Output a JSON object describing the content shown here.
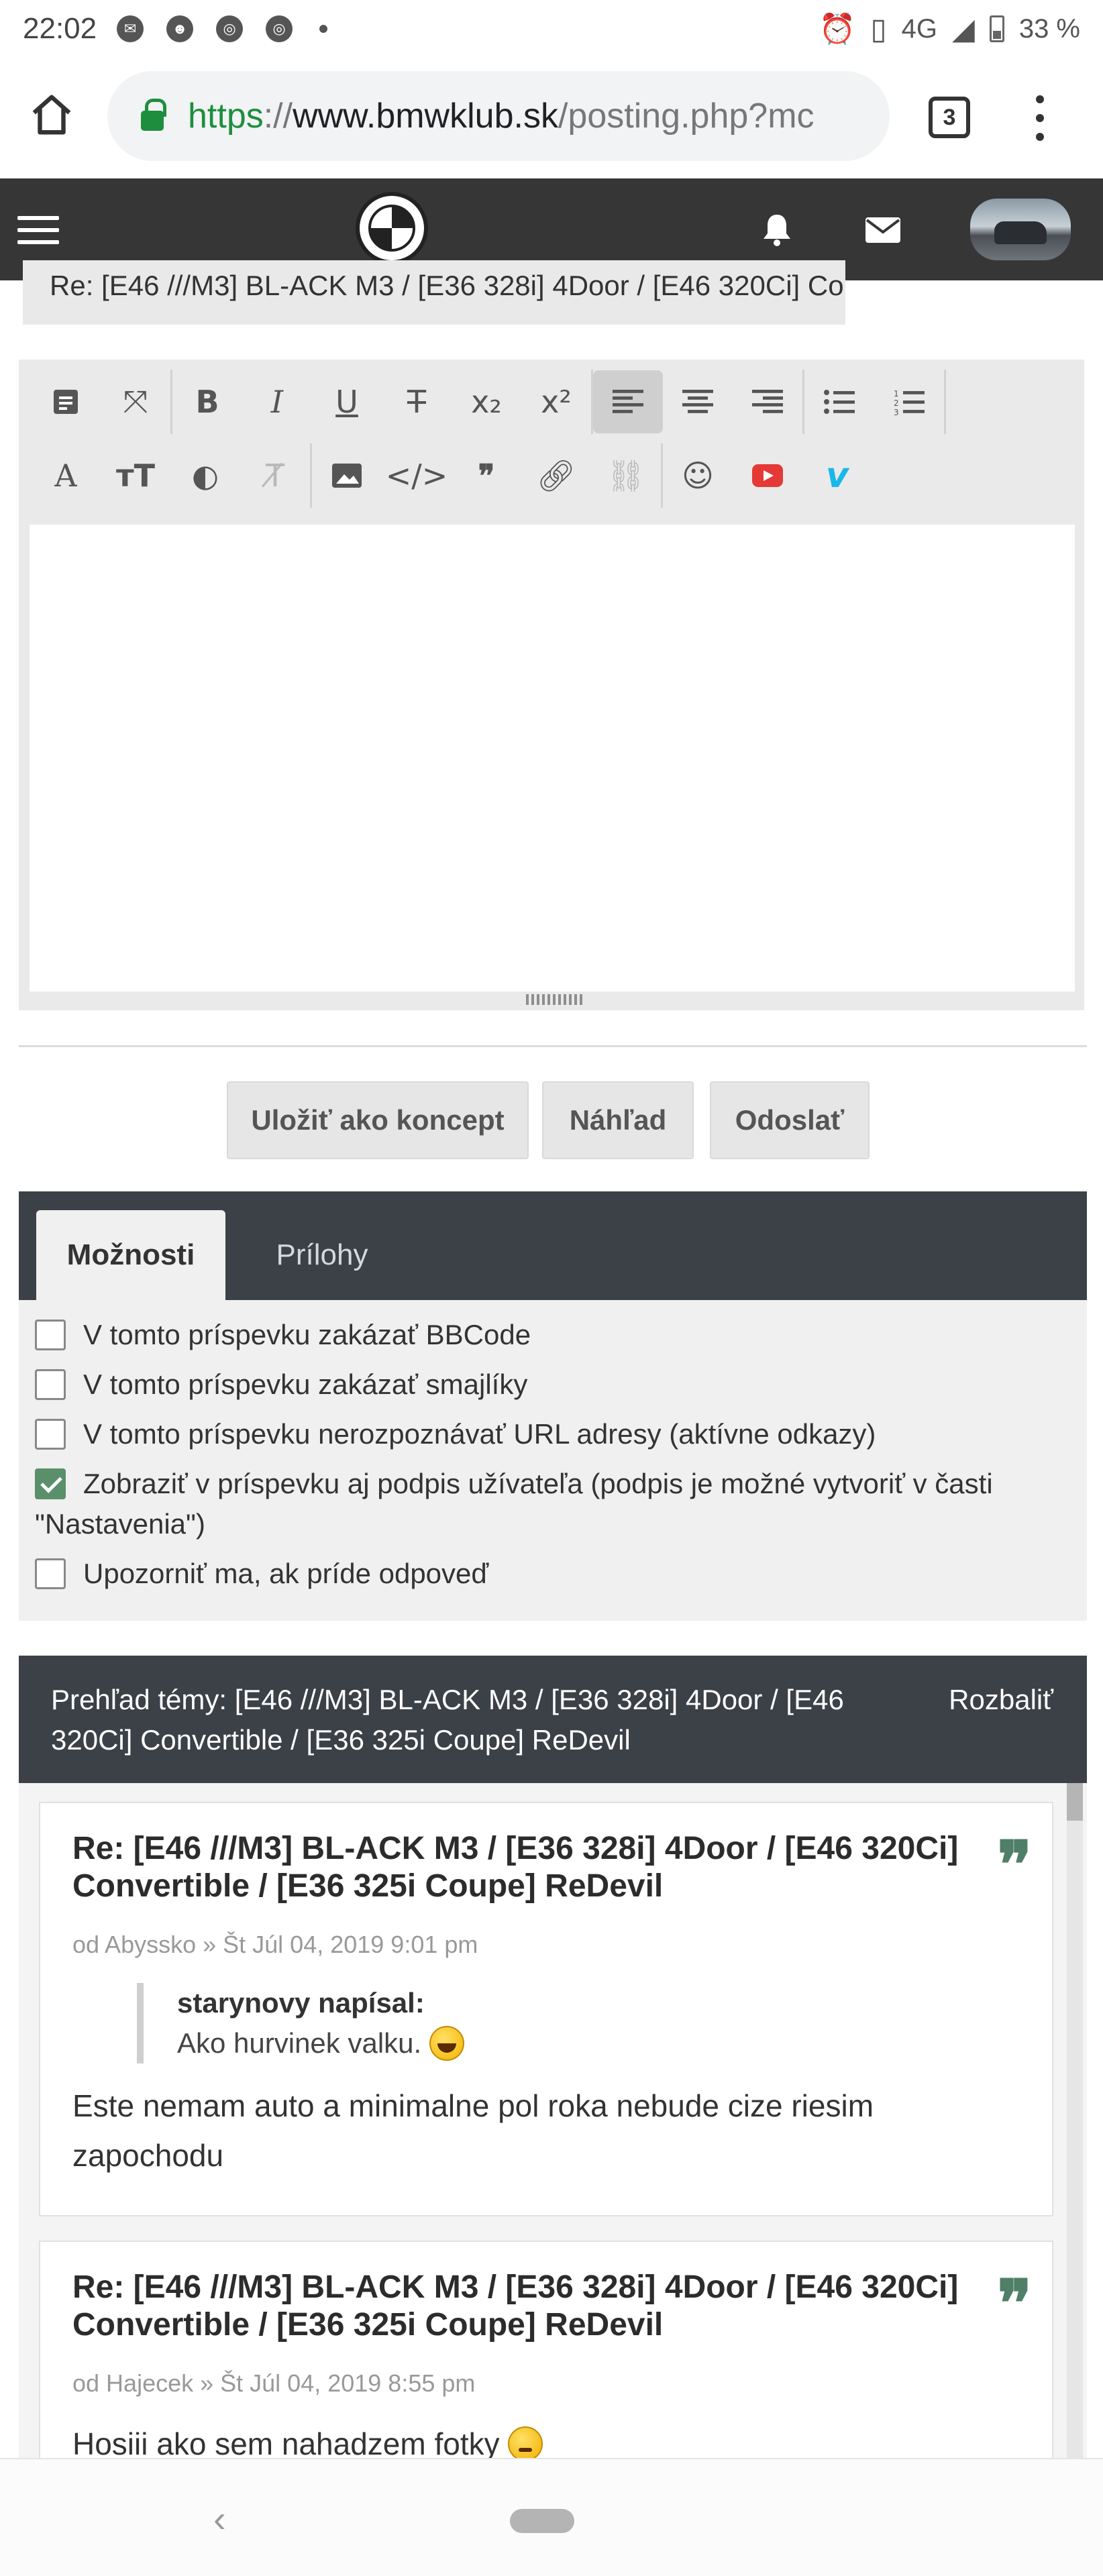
{
  "status_bar": {
    "time": "22:02",
    "network": "4G",
    "battery": "33 %",
    "icons": [
      "messenger-icon",
      "mask-app-icon",
      "chrome-icon",
      "chrome-icon",
      "dot-icon"
    ],
    "right_icons": [
      "alarm-icon",
      "vibrate-icon",
      "signal-icon",
      "battery-icon"
    ]
  },
  "browser": {
    "url_scheme": "https",
    "url_sep": "://",
    "url_host": "www.bmwklub.sk",
    "url_path": "/posting.php?mc",
    "tab_count": "3"
  },
  "site_header": {
    "icons": [
      "hamburger-menu-icon",
      "bmw-logo",
      "bell-icon",
      "mail-icon",
      "avatar"
    ]
  },
  "subject": {
    "value": "Re: [E46 ///M3] BL-ACK M3 / [E36 328i] 4Door / [E46 320Ci] Co"
  },
  "editor": {
    "toolbar_row1": [
      "format-icon",
      "fullscreen-icon",
      "bold-icon",
      "italic-icon",
      "underline-icon",
      "strikethrough-icon",
      "subscript-icon",
      "superscript-icon",
      "align-left-icon",
      "align-center-icon",
      "align-right-icon",
      "bullet-list-icon",
      "numbered-list-icon"
    ],
    "toolbar_row2": [
      "font-icon",
      "font-size-icon",
      "color-icon",
      "remove-format-icon",
      "image-icon",
      "code-icon",
      "quote-icon",
      "link-icon",
      "unlink-icon",
      "emoji-icon",
      "youtube-icon",
      "vimeo-icon"
    ],
    "body": ""
  },
  "actions": {
    "save_draft": "Uložiť ako koncept",
    "preview": "Náhľad",
    "submit": "Odoslať"
  },
  "options": {
    "tabs": [
      {
        "label": "Možnosti",
        "active": true
      },
      {
        "label": "Prílohy",
        "active": false
      }
    ],
    "items": [
      {
        "label": "V tomto príspevku zakázať BBCode",
        "checked": false
      },
      {
        "label": "V tomto príspevku zakázať smajlíky",
        "checked": false
      },
      {
        "label": "V tomto príspevku nerozpoznávať URL adresy (aktívne odkazy)",
        "checked": false
      },
      {
        "label": "Zobraziť v príspevku aj podpis užívateľa (podpis je možné vytvoriť v časti \"Nastavenia\")",
        "checked": true
      },
      {
        "label": "Upozorniť ma, ak príde odpoveď",
        "checked": false
      }
    ]
  },
  "review": {
    "title": "Prehľad témy: [E46 ///M3] BL-ACK M3 / [E36 328i] 4Door / [E46 320Ci] Convertible / [E36 325i Coupe] ReDevil",
    "expand": "Rozbaliť",
    "posts": [
      {
        "title": "Re: [E46 ///M3] BL-ACK M3 / [E36 328i] 4Door / [E46 320Ci] Convertible / [E36 325i Coupe] ReDevil",
        "meta": "od Abyssko » Št Júl 04, 2019 9:01 pm",
        "quote_author": "starynovy napísal:",
        "quote_text": "Ako hurvinek valku.",
        "content": "Este nemam auto a minimalne pol roka nebude cize riesim zapochodu"
      },
      {
        "title": "Re: [E46 ///M3] BL-ACK M3 / [E36 328i] 4Door / [E46 320Ci] Convertible / [E36 325i Coupe] ReDevil",
        "meta": "od Hajecek » Št Júl 04, 2019 8:55 pm",
        "content": "Hosiii ako sem nahadzem fotky"
      }
    ]
  },
  "nav": {
    "back_glyph": "‹"
  },
  "colors": {
    "header_bg": "#363636",
    "panel_dark": "#3c4047",
    "url_green": "#1e8e3e",
    "quote_green": "#4f7f66"
  }
}
